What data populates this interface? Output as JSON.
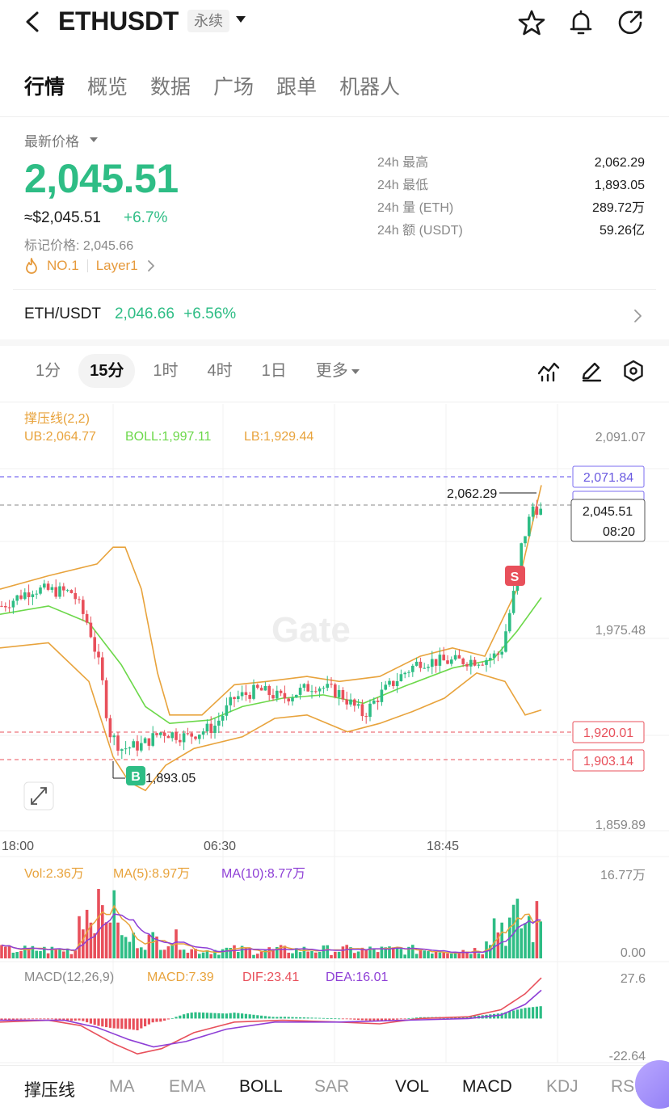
{
  "header": {
    "title": "ETHUSDT",
    "badge": "永续"
  },
  "tabs": [
    "行情",
    "概览",
    "数据",
    "广场",
    "跟单",
    "机器人"
  ],
  "price": {
    "label": "最新价格",
    "last": "2,045.51",
    "approx": "≈$2,045.51",
    "change": "+6.7%",
    "mark": "标记价格: 2,045.66",
    "rank": "NO.1",
    "tag": "Layer1"
  },
  "stats": [
    {
      "k": "24h  最高",
      "v": "2,062.29"
    },
    {
      "k": "24h  最低",
      "v": "1,893.05"
    },
    {
      "k": "24h  量 (ETH)",
      "v": "289.72万"
    },
    {
      "k": "24h  额 (USDT)",
      "v": "59.26亿"
    }
  ],
  "spot": {
    "pair": "ETH/USDT",
    "price": "2,046.66",
    "change": "+6.56%"
  },
  "timeframes": [
    "1分",
    "15分",
    "1时",
    "4时",
    "1日",
    "更多"
  ],
  "active_timeframe": "15分",
  "chart_legend": {
    "name": "撑压线(2,2)",
    "ub": "UB:2,064.77",
    "boll": "BOLL:1,997.11",
    "lb": "LB:1,929.44"
  },
  "price_axis": [
    "2,091.07",
    "1,975.48",
    "1,859.89"
  ],
  "price_tags": {
    "purple": "2,071.84",
    "last": "2,045.51",
    "countdown": "08:20",
    "red1": "1,920.01",
    "red2": "1,903.14"
  },
  "annotations": {
    "high": "2,062.29",
    "low": "1,893.05",
    "buy": "B",
    "sell": "S"
  },
  "watermark": "Gate",
  "time_axis": [
    "18:00",
    "06:30",
    "18:45"
  ],
  "volume": {
    "vol": "Vol:2.36万",
    "ma5": "MA(5):8.97万",
    "ma10": "MA(10):8.77万",
    "max": "16.77万",
    "min": "0.00"
  },
  "macd": {
    "name": "MACD(12,26,9)",
    "macd": "MACD:7.39",
    "dif": "DIF:23.41",
    "dea": "DEA:16.01",
    "max": "27.6",
    "min": "-22.64"
  },
  "indicators": [
    {
      "label": "撑压线",
      "on": true
    },
    {
      "label": "MA",
      "on": false
    },
    {
      "label": "EMA",
      "on": false
    },
    {
      "label": "BOLL",
      "on": true
    },
    {
      "label": "SAR",
      "on": false
    },
    {
      "label": "VOL",
      "on": true
    },
    {
      "label": "MACD",
      "on": true
    },
    {
      "label": "KDJ",
      "on": false
    },
    {
      "label": "RSI",
      "on": false
    }
  ],
  "colors": {
    "up": "#2ebd85",
    "down": "#e8505b",
    "ub": "#e8a33c",
    "boll_mid": "#6cd84a",
    "ma10": "#8e3fd6",
    "dif": "#e8505b",
    "dea": "#8e3fd6"
  }
}
